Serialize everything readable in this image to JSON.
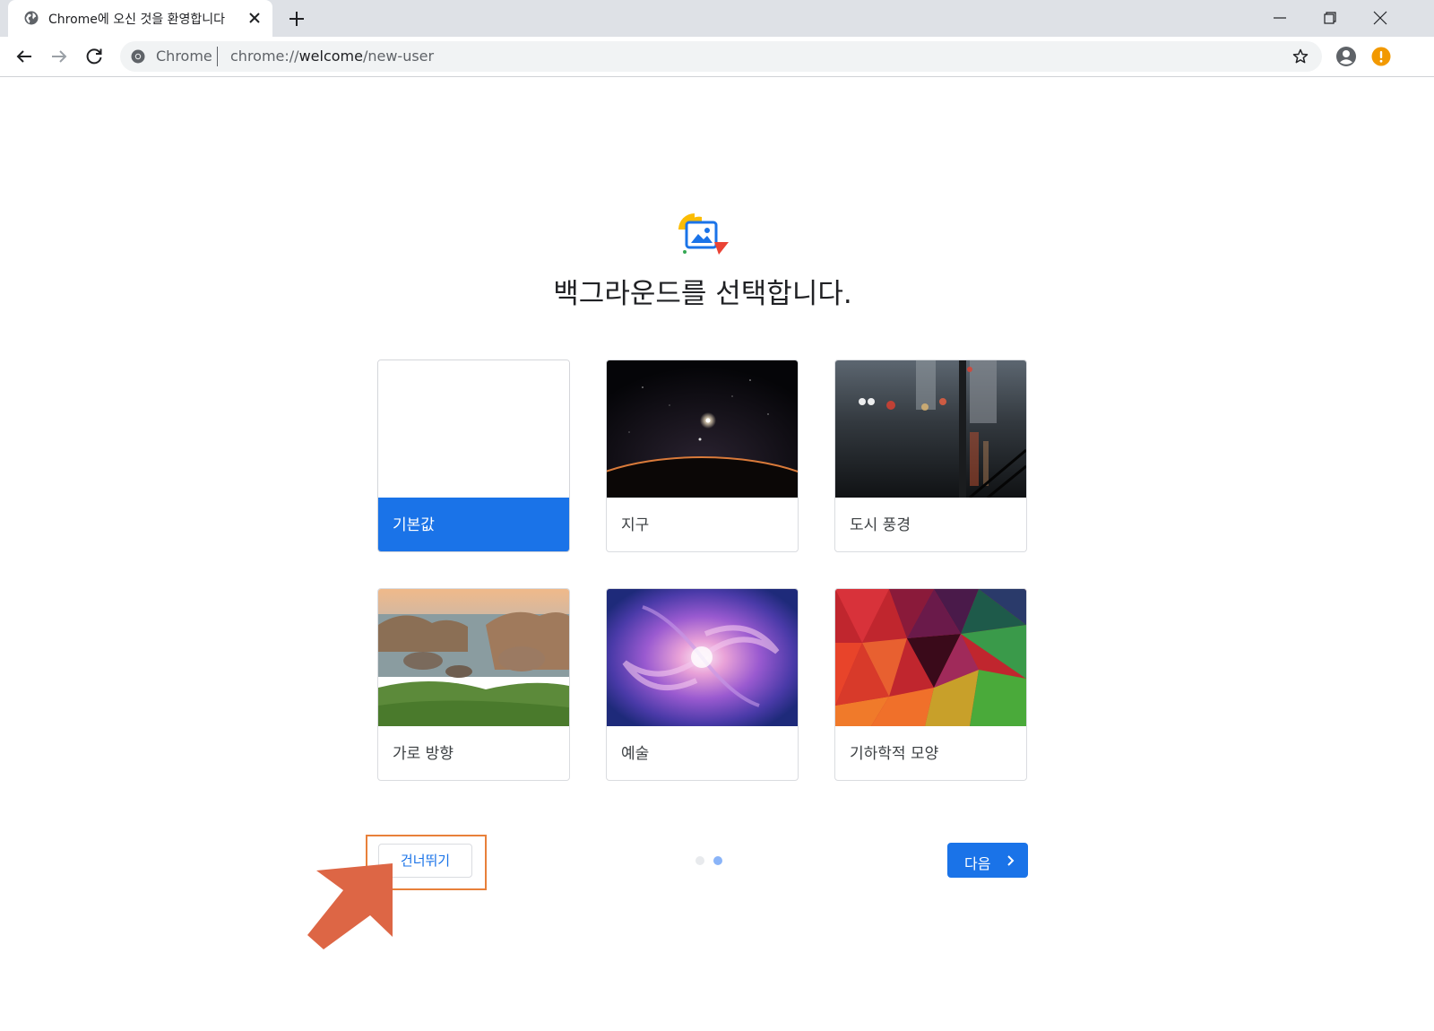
{
  "browser": {
    "tab_title": "Chrome에 오신 것을 환영합니다",
    "omnibox": {
      "chip": "Chrome",
      "url_scheme": "chrome://",
      "url_host": "welcome",
      "url_path": "/new-user"
    }
  },
  "page": {
    "heading": "백그라운드를 선택합니다.",
    "backgrounds": [
      {
        "label": "기본값",
        "selected": true
      },
      {
        "label": "지구",
        "selected": false
      },
      {
        "label": "도시 풍경",
        "selected": false
      },
      {
        "label": "가로 방향",
        "selected": false
      },
      {
        "label": "예술",
        "selected": false
      },
      {
        "label": "기하학적 모양",
        "selected": false
      }
    ],
    "skip_label": "건너뛰기",
    "next_label": "다음",
    "step_current": 2,
    "step_total": 2
  },
  "colors": {
    "accent": "#1a73e8",
    "annotation": "#e8803a",
    "arrow": "#dd6645"
  }
}
